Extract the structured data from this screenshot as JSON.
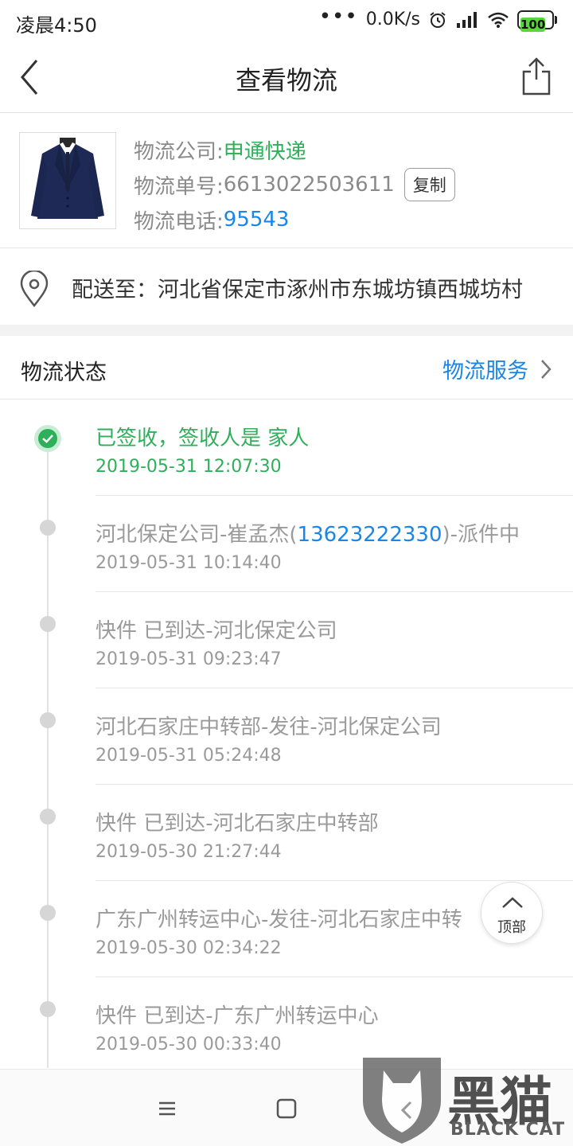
{
  "status_bar": {
    "time": "凌晨4:50",
    "dots": "•••",
    "net_speed": "0.0K/s",
    "battery": "100"
  },
  "header": {
    "title": "查看物流"
  },
  "logistics": {
    "company_label": "物流公司:",
    "company": "申通快递",
    "tracking_label": "物流单号:",
    "tracking_number": "6613022503611",
    "copy_label": "复制",
    "phone_label": "物流电话:",
    "phone": "95543"
  },
  "address": {
    "text": "配送至：河北省保定市涿州市东城坊镇西城坊村"
  },
  "status_section": {
    "title": "物流状态",
    "service_link": "物流服务"
  },
  "timeline": [
    {
      "text": "已签收，签收人是 家人",
      "time": "2019-05-31 12:07:30"
    },
    {
      "text_before": "河北保定公司-崔孟杰(",
      "phone": "13623222330",
      "text_after": ")-派件中",
      "time": "2019-05-31 10:14:40"
    },
    {
      "text": "快件 已到达-河北保定公司",
      "time": "2019-05-31 09:23:47"
    },
    {
      "text": "河北石家庄中转部-发往-河北保定公司",
      "time": "2019-05-31 05:24:48"
    },
    {
      "text": "快件 已到达-河北石家庄中转部",
      "time": "2019-05-30 21:27:44"
    },
    {
      "text": "广东广州转运中心-发往-河北石家庄中转",
      "time": "2019-05-30 02:34:22"
    },
    {
      "text": "快件 已到达-广东广州转运中心",
      "time": "2019-05-30 00:33:40"
    }
  ],
  "back_to_top": {
    "label": "顶部"
  },
  "watermark": {
    "cn": "黑猫",
    "en": "BLACK CAT"
  },
  "colors": {
    "green": "#2eaf5a",
    "blue": "#1a86e8",
    "gray_text": "#9a9a9a"
  },
  "icons": [
    "back-arrow-icon",
    "share-icon",
    "location-pin-icon",
    "chevron-right-icon",
    "check-icon",
    "chevron-up-icon",
    "menu-icon",
    "home-square-icon",
    "back-triangle-icon",
    "alarm-icon",
    "signal-icon",
    "wifi-icon",
    "battery-icon"
  ]
}
